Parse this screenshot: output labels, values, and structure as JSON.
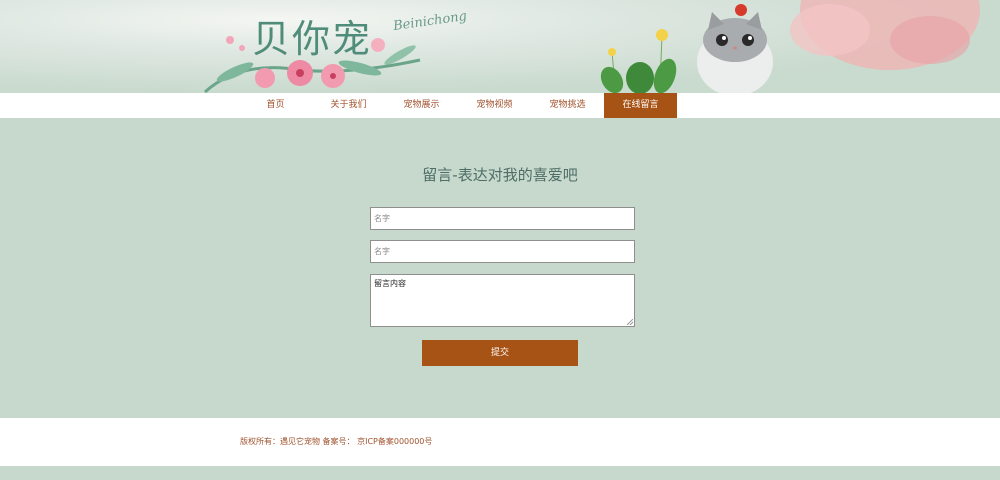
{
  "header": {
    "logo": "贝你宠",
    "logo_sub": "Beinichong"
  },
  "nav": {
    "items": [
      {
        "label": "首页"
      },
      {
        "label": "关于我们"
      },
      {
        "label": "宠物展示"
      },
      {
        "label": "宠物视频"
      },
      {
        "label": "宠物挑选"
      },
      {
        "label": "在线留言"
      }
    ],
    "active_index": 5
  },
  "form": {
    "title": "留言-表达对我的喜爱吧",
    "name_placeholder": "名字",
    "name2_placeholder": "名字",
    "content_value": "留言内容",
    "submit_label": "提交"
  },
  "footer": {
    "copyright": "版权所有：遇见它宠物 备案号： 京ICP备案000000号"
  },
  "colors": {
    "accent": "#a85316",
    "background": "#c7d8cd",
    "nav_text": "#a0522d"
  }
}
